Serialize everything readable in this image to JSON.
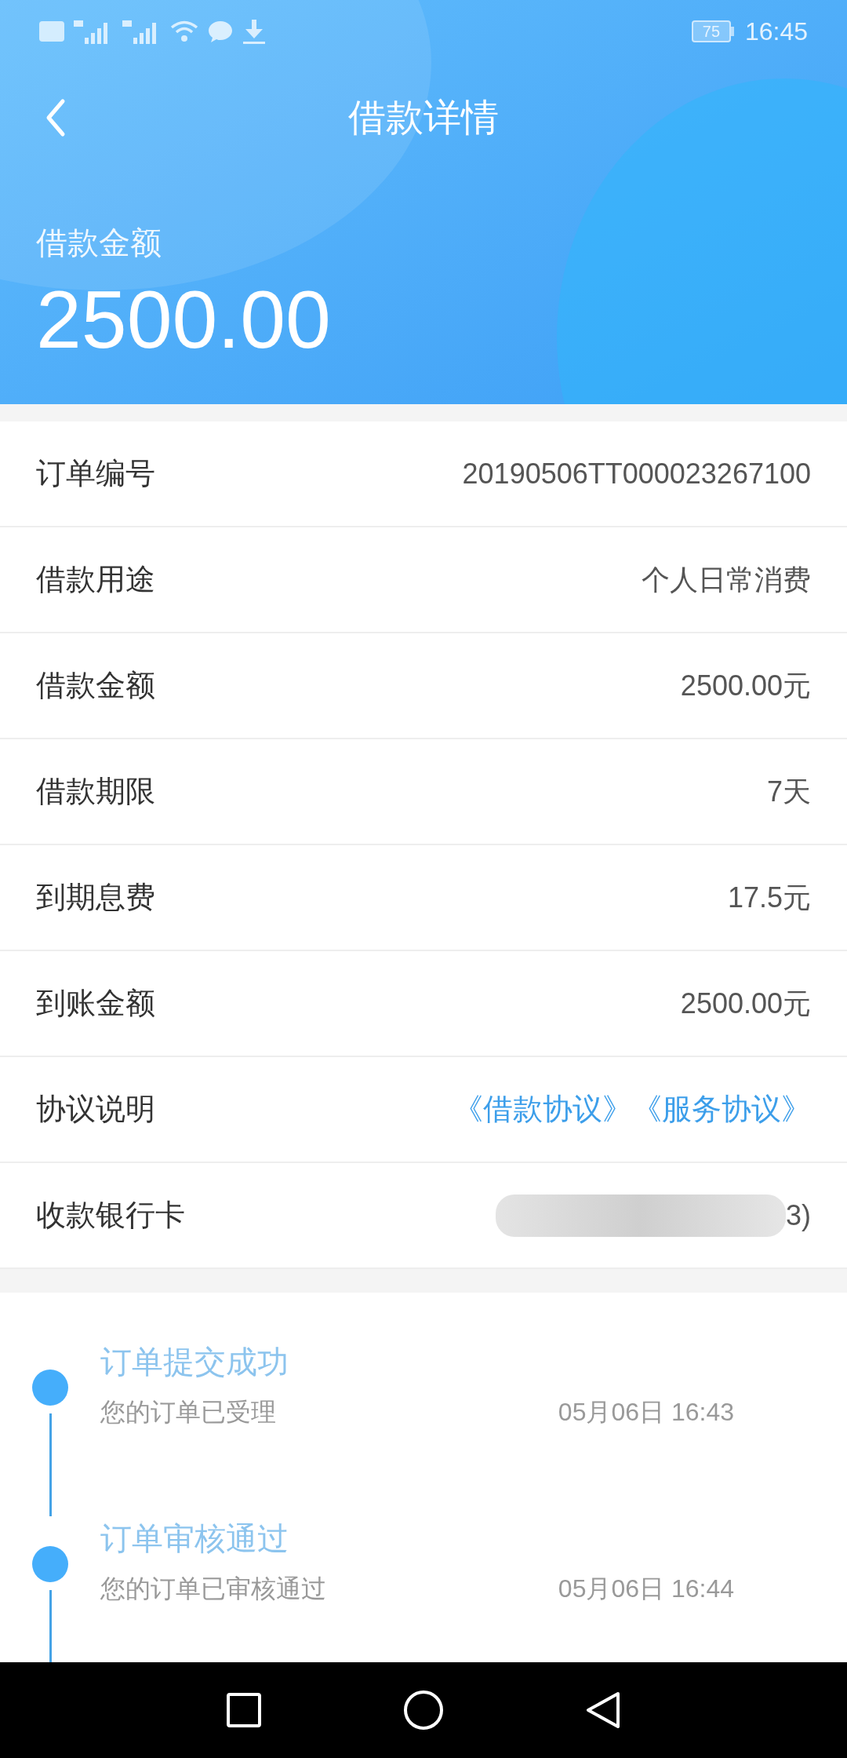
{
  "status_bar": {
    "battery": "75",
    "time": "16:45"
  },
  "header": {
    "title": "借款详情",
    "amount_label": "借款金额",
    "amount": "2500.00"
  },
  "details": [
    {
      "kind": "text",
      "label": "订单编号",
      "value": "20190506TT000023267100"
    },
    {
      "kind": "text",
      "label": "借款用途",
      "value": "个人日常消费"
    },
    {
      "kind": "text",
      "label": "借款金额",
      "value": "2500.00元"
    },
    {
      "kind": "text",
      "label": "借款期限",
      "value": "7天"
    },
    {
      "kind": "text",
      "label": "到期息费",
      "value": "17.5元"
    },
    {
      "kind": "text",
      "label": "到账金额",
      "value": "2500.00元"
    },
    {
      "kind": "links",
      "label": "协议说明",
      "links": [
        "《借款协议》",
        "《服务协议》"
      ]
    },
    {
      "kind": "redacted",
      "label": "收款银行卡",
      "value": "3)"
    }
  ],
  "timeline": [
    {
      "title": "订单提交成功",
      "detail": "您的订单已受理",
      "time": "05月06日 16:43"
    },
    {
      "title": "订单审核通过",
      "detail": "您的订单已审核通过",
      "time": "05月06日 16:44"
    }
  ]
}
